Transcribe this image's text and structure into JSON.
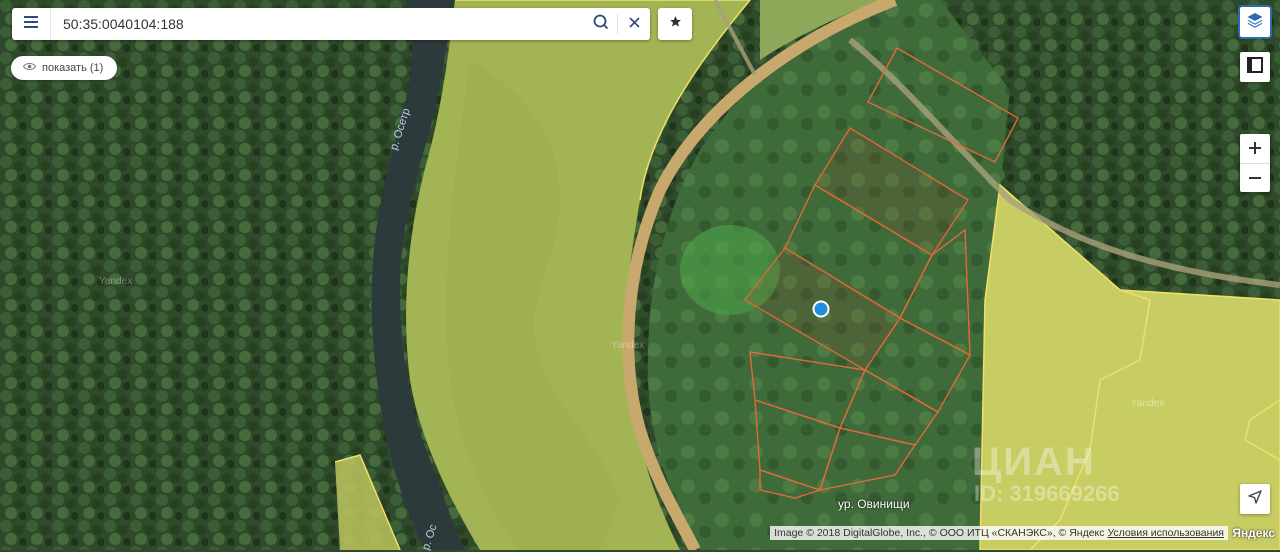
{
  "search": {
    "value": "50:35:0040104:188"
  },
  "show_button": {
    "label": "показать (1)"
  },
  "map": {
    "river_label_upper": "р. Осетр",
    "river_label_lower": "р. Ос",
    "place_label": "ур. Овинищи",
    "tile_label_left": "Yandex",
    "tile_label_center": "Yandex",
    "tile_label_right": "Yandex"
  },
  "attribution": {
    "text": "Image © 2018 DigitalGlobe, Inc., © ООО ИТЦ «СКАНЭКС», © Яндекс",
    "terms_link": "Условия использования",
    "logo": "Яндекс"
  },
  "watermark": {
    "brand": "ЦИАН",
    "listing_id": "ID: 319669266"
  },
  "icons": {
    "menu": "menu-icon",
    "search": "search-icon",
    "clear": "close-icon",
    "favorite": "star-icon",
    "show": "eye-icon",
    "layers": "layers-icon",
    "panel": "panel-icon",
    "zoom_in": "plus-icon",
    "zoom_out": "minus-icon",
    "locate": "navigation-arrow-icon"
  },
  "colors": {
    "accent": "#2c6ab3",
    "parcel_outline": "#e06a3a",
    "parcel_highlight": "#f0e06a",
    "marker": "#1f8ee0"
  }
}
